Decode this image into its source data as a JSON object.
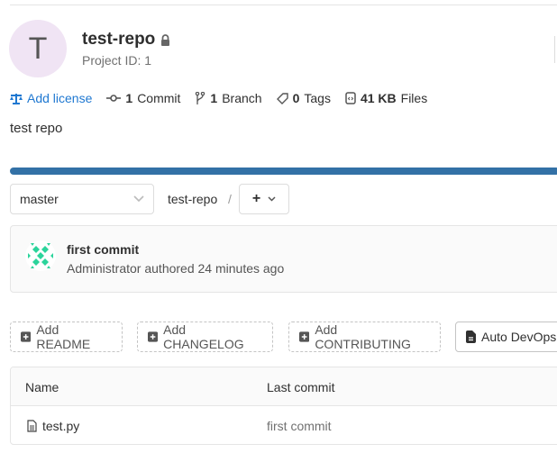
{
  "project": {
    "avatar_letter": "T",
    "name": "test-repo",
    "id_label": "Project ID: 1",
    "description": "test repo"
  },
  "stats": {
    "license": "Add license",
    "commits_count": "1",
    "commits_label": "Commit",
    "branches_count": "1",
    "branches_label": "Branch",
    "tags_count": "0",
    "tags_label": "Tags",
    "size": "41 KB",
    "size_label": "Files"
  },
  "languages": [
    {
      "color": "#3371a6",
      "percent": 100
    }
  ],
  "nav": {
    "branch": "master",
    "breadcrumb": "test-repo",
    "separator": "/",
    "add": "+"
  },
  "last_commit": {
    "message": "first commit",
    "author_line": "Administrator authored 24 minutes ago"
  },
  "actions": {
    "readme": "Add README",
    "changelog": "Add CHANGELOG",
    "contributing": "Add CONTRIBUTING",
    "autodevops": "Auto DevOps"
  },
  "table": {
    "headers": {
      "name": "Name",
      "last_commit": "Last commit"
    },
    "rows": [
      {
        "name": "test.py",
        "last_commit": "first commit"
      }
    ]
  }
}
